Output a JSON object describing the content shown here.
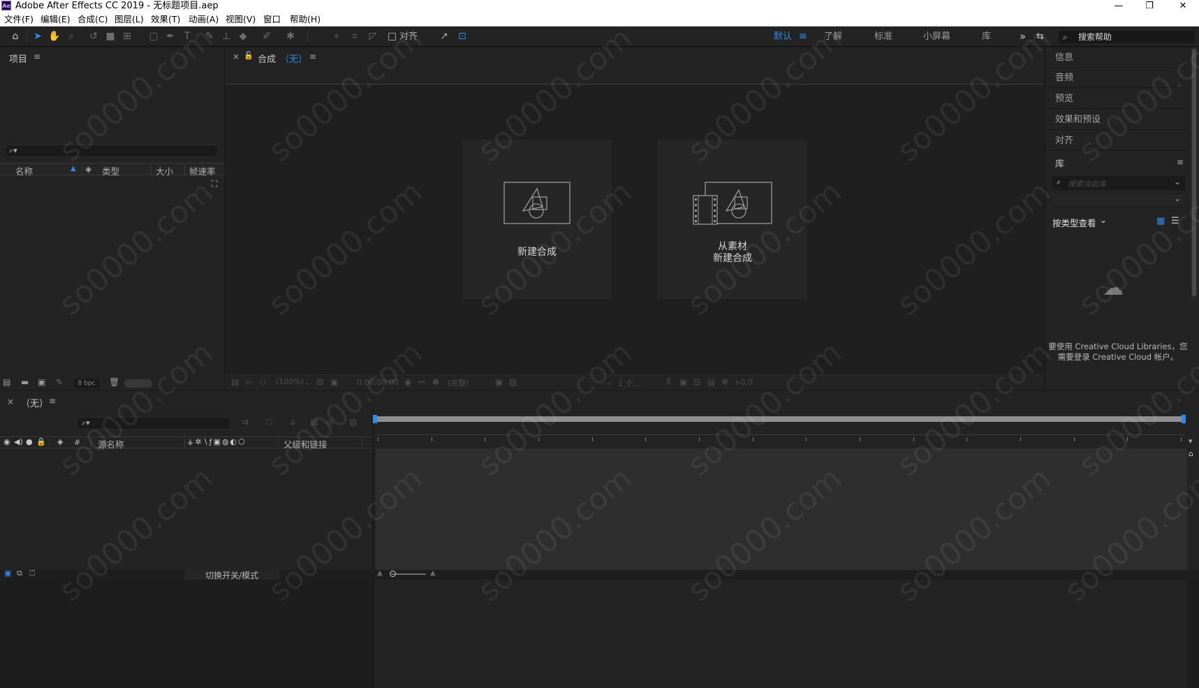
{
  "window": {
    "title": "Adobe After Effects CC 2019 - 无标题项目.aep",
    "logo": "Ae",
    "controls": [
      "—",
      "❐",
      "✕"
    ]
  },
  "menu": [
    "文件(F)",
    "编辑(E)",
    "合成(C)",
    "图层(L)",
    "效果(T)",
    "动画(A)",
    "视图(V)",
    "窗口",
    "帮助(H)"
  ],
  "toolbar": {
    "align_label": "对齐",
    "workspaces": [
      "默认",
      "了解",
      "标准",
      "小屏幕",
      "库"
    ],
    "active_workspace": "默认",
    "overflow": "»",
    "search_placeholder": "搜索帮助"
  },
  "project_panel": {
    "title": "项目",
    "menu_icon": "≡",
    "columns": [
      "名称",
      "类型",
      "大小",
      "帧速率"
    ],
    "bpc": "8 bpc"
  },
  "comp_panel": {
    "close": "×",
    "title": "合成",
    "comp_name": "（无）",
    "menu_icon": "≡",
    "new_comp": "新建合成",
    "from_footage_line1": "从素材",
    "from_footage_line2": "新建合成",
    "zoom": "(100%)",
    "timecode": "0:00:00:00",
    "resolution": "(完整)",
    "views": "1 个...",
    "exposure": "+0.0"
  },
  "right_panel": {
    "items": [
      "信息",
      "音频",
      "预览",
      "效果和预设",
      "对齐"
    ],
    "library_title": "库",
    "menu_icon": "≡",
    "library_search_placeholder": "搜索当前库",
    "view_by_type": "按类型查看",
    "cc_message_line1": "要使用 Creative Cloud Libraries，您",
    "cc_message_line2": "需要登录 Creative Cloud 帐户。"
  },
  "timeline": {
    "close": "×",
    "comp_name": "（无）",
    "menu_icon": "≡",
    "columns": [
      "#",
      "源名称",
      "父级和链接"
    ],
    "toggle_label": "切换开关/模式"
  },
  "watermark": "so0000.com",
  "colors": {
    "accent": "#2d8ceb",
    "panel": "#232323",
    "background": "#1d1d1d"
  }
}
